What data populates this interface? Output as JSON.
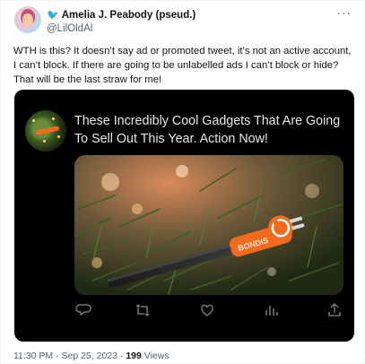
{
  "tweet": {
    "display_name": "Amelia J. Peabody (pseud.)",
    "name_emoji": "🐦",
    "handle": "@LilOldAl",
    "more_label": "···",
    "text": "WTH is this?  It doesn’t say ad or promoted tweet, it’s not an active account, I can’t block. If there are going to be unlabelled ads I can’t block or hide?  That will be the last straw for me!",
    "timestamp": "11:30 PM · Sep 25, 2023",
    "separator": " · ",
    "views_count": "199",
    "views_label": " Views"
  },
  "ad_card": {
    "headline": "These Incredibly Cool Gadgets That Are Going To Sell Out This Year. Action Now!",
    "image_text": "BONDIS",
    "actions": [
      "reply-icon",
      "retweet-icon",
      "like-icon",
      "views-icon",
      "share-icon"
    ]
  },
  "colors": {
    "text_primary": "#0f1419",
    "text_secondary": "#536471",
    "card_bg": "#000000",
    "card_text": "#e7e9ea",
    "accent_orange": "#f26a1b"
  }
}
